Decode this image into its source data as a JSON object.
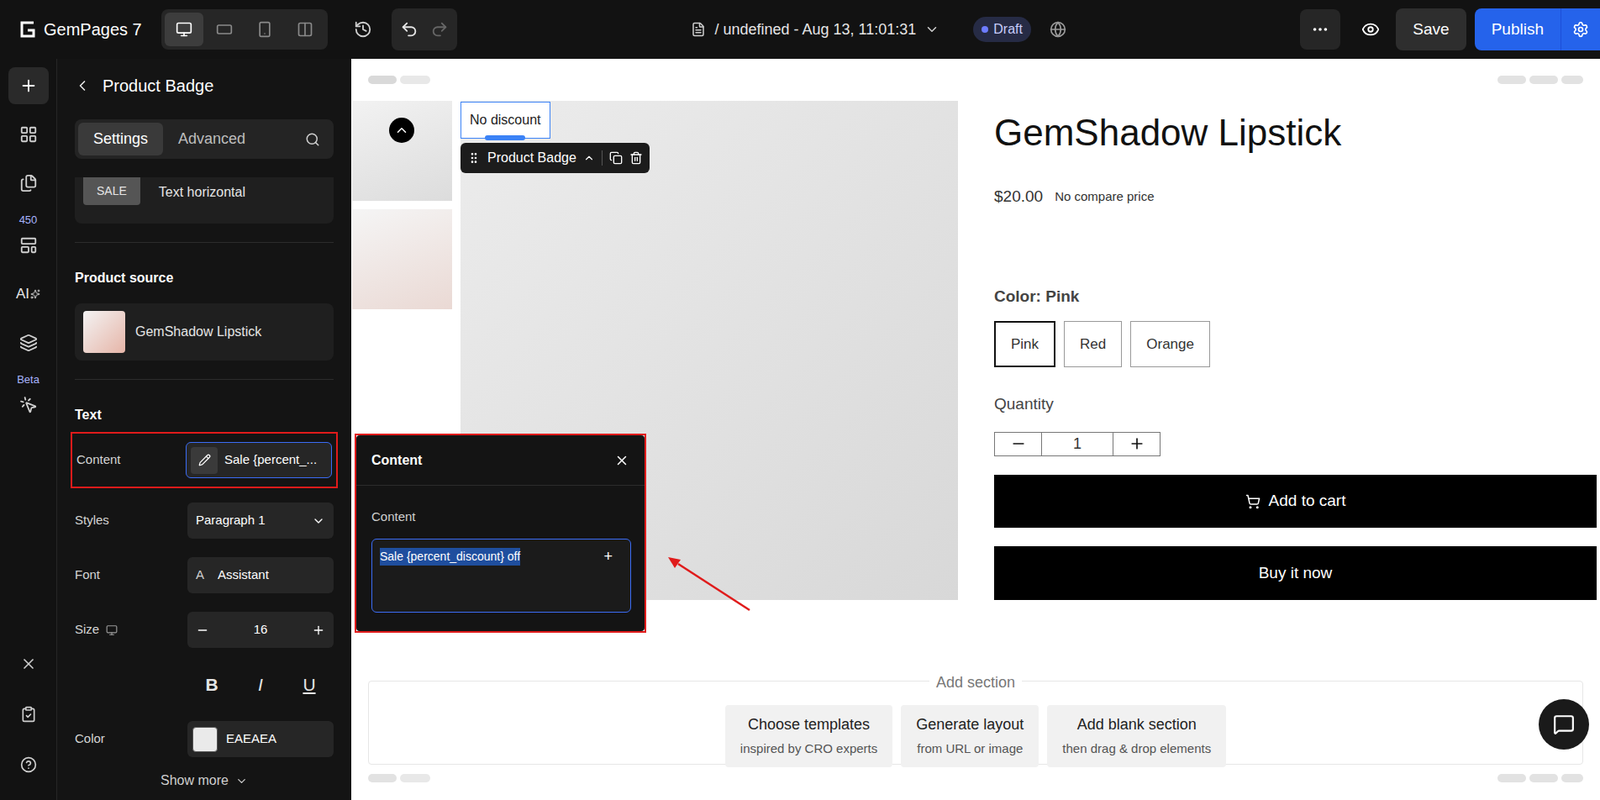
{
  "toolbar": {
    "logo": "GemPages 7",
    "devices": [
      {
        "selected": true
      },
      {
        "selected": false
      },
      {
        "selected": false
      },
      {
        "selected": false
      }
    ],
    "page_title": "/ undefined - Aug 13, 11:01:31",
    "status": "Draft",
    "save": "Save",
    "publish": "Publish"
  },
  "rail": {
    "items": [
      {
        "selected": true
      },
      {
        "selected": false
      },
      {
        "selected": false
      },
      {
        "selected": false,
        "badge": "450"
      },
      {
        "selected": false,
        "label": "AI"
      },
      {
        "selected": false
      },
      {
        "selected": false,
        "badge": "Beta"
      }
    ],
    "bottom": [
      {
        "selected": false
      },
      {
        "selected": false
      },
      {
        "selected": false
      }
    ]
  },
  "panel": {
    "title": "Product Badge",
    "tabs": [
      {
        "label": "Settings",
        "selected": true
      },
      {
        "label": "Advanced",
        "selected": false
      }
    ],
    "badge_style": {
      "sample": "SALE",
      "label": "Text horizontal"
    },
    "product_source": {
      "heading": "Product source",
      "product": "GemShadow Lipstick"
    },
    "text_section": {
      "heading": "Text",
      "content_label": "Content",
      "content_value": "Sale {percent_...",
      "styles_label": "Styles",
      "styles_value": "Paragraph 1",
      "font_label": "Font",
      "font_value": "Assistant",
      "size_label": "Size",
      "size_value": "16",
      "format": [
        {
          "label": "B",
          "kind": "bold",
          "selected": false
        },
        {
          "label": "I",
          "kind": "italic",
          "selected": false
        },
        {
          "label": "U",
          "kind": "underline",
          "selected": false
        }
      ],
      "color_label": "Color",
      "color_value": "EAEAEA",
      "show_more": "Show more"
    }
  },
  "popup": {
    "title": "Content",
    "label": "Content",
    "value": "Sale {percent_discount} off",
    "selected": true,
    "add": "+"
  },
  "canvas": {
    "badge": "No discount",
    "badge_toolbar": "Product Badge",
    "product": {
      "title": "GemShadow Lipstick",
      "price": "$20.00",
      "compare": "No compare price",
      "option": "Color: Pink",
      "values": [
        {
          "label": "Pink",
          "selected": true
        },
        {
          "label": "Red",
          "selected": false
        },
        {
          "label": "Orange",
          "selected": false
        }
      ],
      "quantity_label": "Quantity",
      "quantity": "1",
      "add_to_cart": "Add to cart",
      "buy_now": "Buy it now"
    },
    "add_section": {
      "label": "Add section",
      "options": [
        {
          "title": "Choose templates",
          "subtitle": "inspired by CRO experts"
        },
        {
          "title": "Generate layout",
          "subtitle": "from URL or image"
        },
        {
          "title": "Add blank section",
          "subtitle": "then drag & drop elements"
        }
      ]
    }
  }
}
